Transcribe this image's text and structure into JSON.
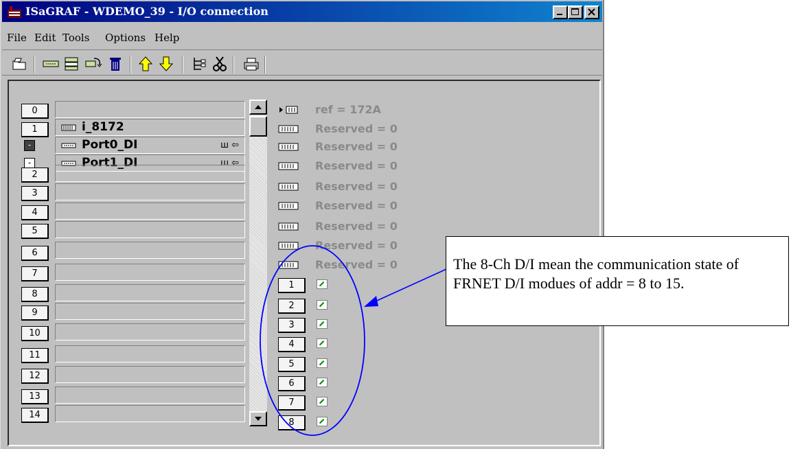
{
  "window": {
    "title": "ISaGRAF - WDEMO_39 - I/O connection"
  },
  "menu": [
    "File",
    "Edit",
    "Tools",
    "Options",
    "Help"
  ],
  "toolbar_icons": [
    "open-icon",
    "board-icon",
    "equipment-icon",
    "equipment-refresh-icon",
    "trash-icon",
    "arrow-up-icon",
    "arrow-down-icon",
    "tree-icon",
    "cut-icon",
    "print-icon"
  ],
  "slots": [
    {
      "num": "0",
      "label": ""
    },
    {
      "num": "1",
      "label": "i_8172"
    },
    {
      "num": "2",
      "label": ""
    },
    {
      "num": "3",
      "label": ""
    },
    {
      "num": "4",
      "label": ""
    },
    {
      "num": "5",
      "label": ""
    },
    {
      "num": "6",
      "label": ""
    },
    {
      "num": "7",
      "label": ""
    },
    {
      "num": "8",
      "label": ""
    },
    {
      "num": "9",
      "label": ""
    },
    {
      "num": "10",
      "label": ""
    },
    {
      "num": "11",
      "label": ""
    },
    {
      "num": "12",
      "label": ""
    },
    {
      "num": "13",
      "label": ""
    },
    {
      "num": "14",
      "label": ""
    }
  ],
  "ports": [
    {
      "label": "Port0_DI",
      "toggle": "-",
      "signal": "ꟺ ⇦"
    },
    {
      "label": "Port1_DI",
      "toggle": "-",
      "signal": "ꟺ ⇦"
    }
  ],
  "params": [
    "ref = 172A",
    "Reserved = 0",
    "Reserved = 0",
    "Reserved = 0",
    "Reserved = 0",
    "Reserved = 0",
    "Reserved = 0",
    "Reserved = 0",
    "Reserved = 0"
  ],
  "channels": [
    "1",
    "2",
    "3",
    "4",
    "5",
    "6",
    "7",
    "8"
  ],
  "callout": {
    "text": "The 8-Ch D/I mean the communication state of FRNET D/I modues of addr = 8 to 15."
  },
  "colors": {
    "title_bar": "#000080",
    "window_face": "#c0c0c0",
    "param_text": "#8a8a8a",
    "annotation": "#0000ff"
  }
}
